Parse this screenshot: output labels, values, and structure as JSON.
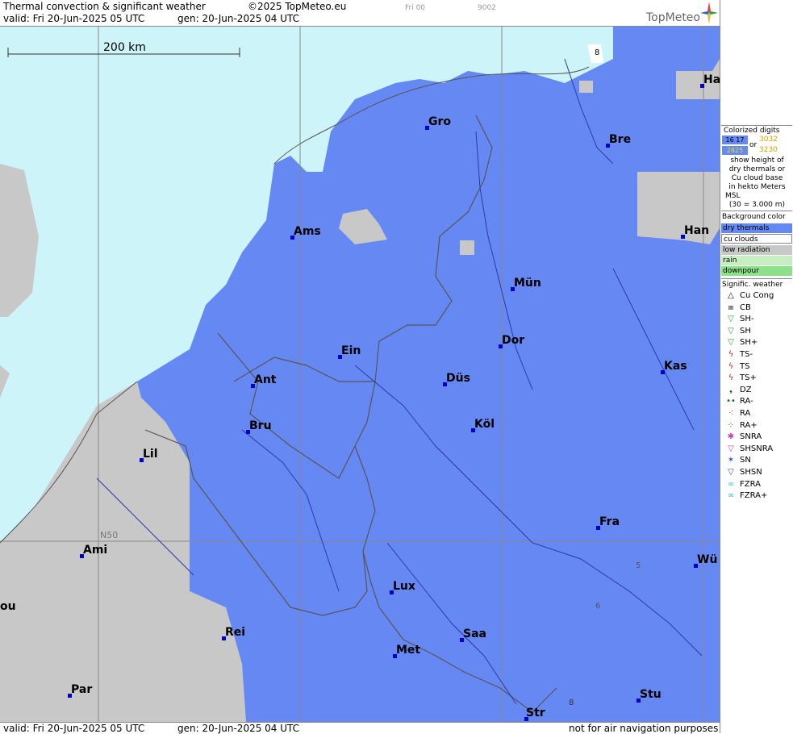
{
  "header": {
    "title": "Thermal convection & significant weather",
    "copyright": "©2025 TopMeteo.eu",
    "valid": "valid:  Fri  20-Jun-2025  05 UTC",
    "gen": "gen:  20-Jun-2025  04 UTC",
    "step": "Fri 00",
    "code": "9002",
    "logo": "TopMeteo"
  },
  "map": {
    "scale_label": "200 km",
    "latitude_label": "N50",
    "colors": {
      "sea": "#cdf4f8",
      "dry_thermals": "#6688f2",
      "low_radiation": "#c8c8c8",
      "grid": "#888888",
      "border": "#555555",
      "river": "#2b3aa8",
      "city_dot": "#0000cc"
    },
    "contour_digits": [
      "8",
      "8",
      "5",
      "6"
    ],
    "cities": [
      "Gro",
      "Bre",
      "Ha",
      "Ams",
      "Han",
      "Mün",
      "Ein",
      "Dor",
      "Kas",
      "Ant",
      "Düs",
      "Bru",
      "Köl",
      "Lil",
      "Fra",
      "Ami",
      "Wü",
      "Lux",
      "Rei",
      "Saa",
      "Met",
      "ou",
      "Par",
      "Stu",
      "Str"
    ]
  },
  "legend": {
    "colorized": {
      "title": "Colorized digits",
      "sample1": "16 17",
      "or": "or",
      "sample2": "3032",
      "sample3": "2825",
      "sample4": "3230",
      "lines": [
        "show height of",
        "dry thermals or",
        "Cu cloud base",
        "in hekto Meters",
        "MSL",
        "(30 = 3.000 m)"
      ]
    },
    "background": {
      "title": "Background color",
      "items": [
        {
          "label": "dry thermals",
          "color": "#6688f2"
        },
        {
          "label": "cu clouds",
          "color": "#ffffff"
        },
        {
          "label": "low radiation",
          "color": "#c8c8c8"
        },
        {
          "label": "rain",
          "color": "#c7eec0"
        },
        {
          "label": "downpour",
          "color": "#8fe08a"
        }
      ]
    },
    "weather": {
      "title": "Signific. weather",
      "items": [
        {
          "label": "Cu Cong",
          "symbol": "△",
          "color": "#000000"
        },
        {
          "label": "CB",
          "symbol": "⩎",
          "color": "#000000"
        },
        {
          "label": "SH-",
          "symbol": "▽",
          "color": "#2f9a2f"
        },
        {
          "label": "SH",
          "symbol": "▽",
          "color": "#2f9a2f"
        },
        {
          "label": "SH+",
          "symbol": "▽",
          "color": "#2f9a2f"
        },
        {
          "label": "TS-",
          "symbol": "ϟ",
          "color": "#cc2222"
        },
        {
          "label": "TS",
          "symbol": "ϟ",
          "color": "#cc2222"
        },
        {
          "label": "TS+",
          "symbol": "ϟ",
          "color": "#cc2222"
        },
        {
          "label": "DZ",
          "symbol": "❟",
          "color": "#1a6a1a"
        },
        {
          "label": "RA-",
          "symbol": "••",
          "color": "#1a6a1a"
        },
        {
          "label": "RA",
          "symbol": "⁖",
          "color": "#1a6a1a"
        },
        {
          "label": "RA+",
          "symbol": "⁘",
          "color": "#1a6a1a"
        },
        {
          "label": "SNRA",
          "symbol": "✱",
          "color": "#c040c0"
        },
        {
          "label": "SHSNRA",
          "symbol": "▽",
          "color": "#c040c0"
        },
        {
          "label": "SN",
          "symbol": "✶",
          "color": "#3050c0"
        },
        {
          "label": "SHSN",
          "symbol": "▽",
          "color": "#3050c0"
        },
        {
          "label": "FZRA",
          "symbol": "∞",
          "color": "#30c0e0"
        },
        {
          "label": "FZRA+",
          "symbol": "∞",
          "color": "#30c0e0"
        }
      ]
    }
  },
  "footer": {
    "valid": "valid:  Fri  20-Jun-2025  05 UTC",
    "gen": "gen:  20-Jun-2025  04 UTC",
    "disclaimer": "not for air navigation purposes"
  }
}
